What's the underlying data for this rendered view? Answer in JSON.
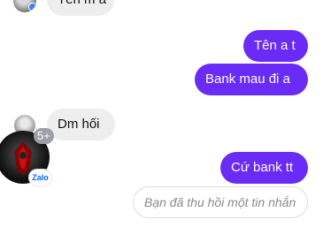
{
  "messages": [
    {
      "text": "Tên m a",
      "direction": "incoming"
    },
    {
      "text": "Tên a t",
      "direction": "outgoing"
    },
    {
      "text": "Bank mau đi a",
      "direction": "outgoing"
    },
    {
      "text": "Dm hối",
      "direction": "incoming"
    },
    {
      "text": "Cứ bank tt",
      "direction": "outgoing"
    }
  ],
  "recalled_notice": "Bạn đã thu hồi một tin nhắn",
  "group_badge": "5+",
  "app_tag": "Zalo",
  "colors": {
    "outgoing_bubble": "#6a2bf7",
    "incoming_bubble": "#eeeeee",
    "zalo_blue": "#0068ff"
  },
  "icons": [
    "avatar-top",
    "avatar-mid",
    "avatar-group"
  ]
}
